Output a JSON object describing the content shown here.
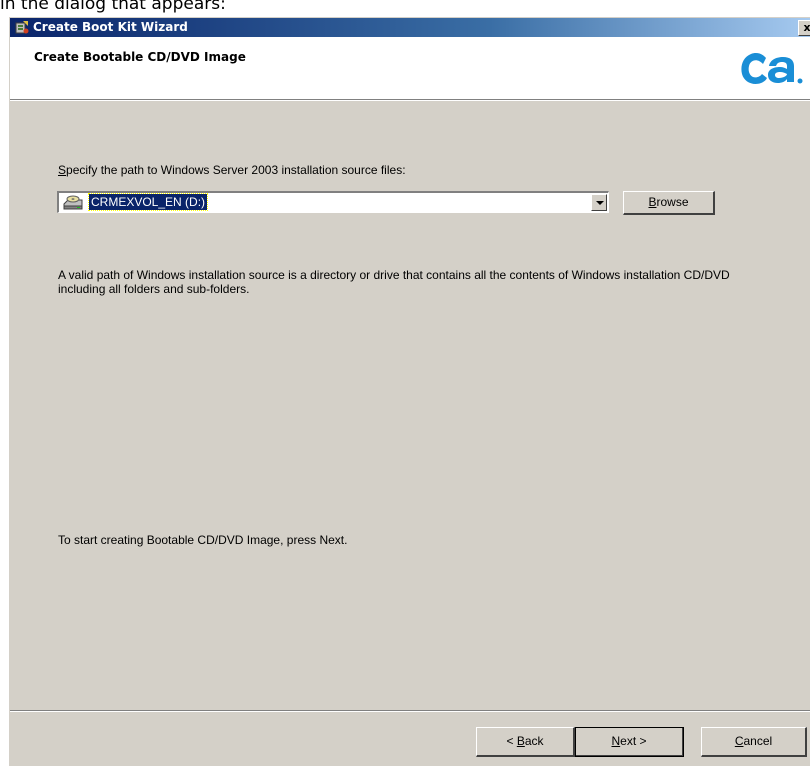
{
  "caption": "in the dialog that appears:",
  "window": {
    "title": "Create Boot Kit Wizard",
    "close_glyph": "x"
  },
  "header": {
    "title": "Create Bootable CD/DVD Image",
    "logo_text": "ca",
    "logo_color": "#1a8ed6"
  },
  "main": {
    "path_label_mnemonic": "S",
    "path_label_rest": "pecify the path to Windows Server 2003 installation source files:",
    "path_value": "CRMEXVOL_EN (D:)",
    "info_text": "A valid path of Windows installation source is a directory or drive that contains all the contents of Windows installation CD/DVD including all folders and sub-folders.",
    "start_text": "To start creating Bootable CD/DVD Image, press Next."
  },
  "buttons": {
    "browse_mnemonic": "B",
    "browse_rest": "rowse",
    "back_prefix": "< ",
    "back_mnemonic": "B",
    "back_rest": "ack",
    "next_mnemonic": "N",
    "next_rest": "ext >",
    "cancel_mnemonic": "C",
    "cancel_rest": "ancel"
  },
  "icons": {
    "title_icon": "wizard-app-icon",
    "drive_icon": "cd-drive-icon",
    "dropdown_icon": "chevron-down-icon"
  }
}
